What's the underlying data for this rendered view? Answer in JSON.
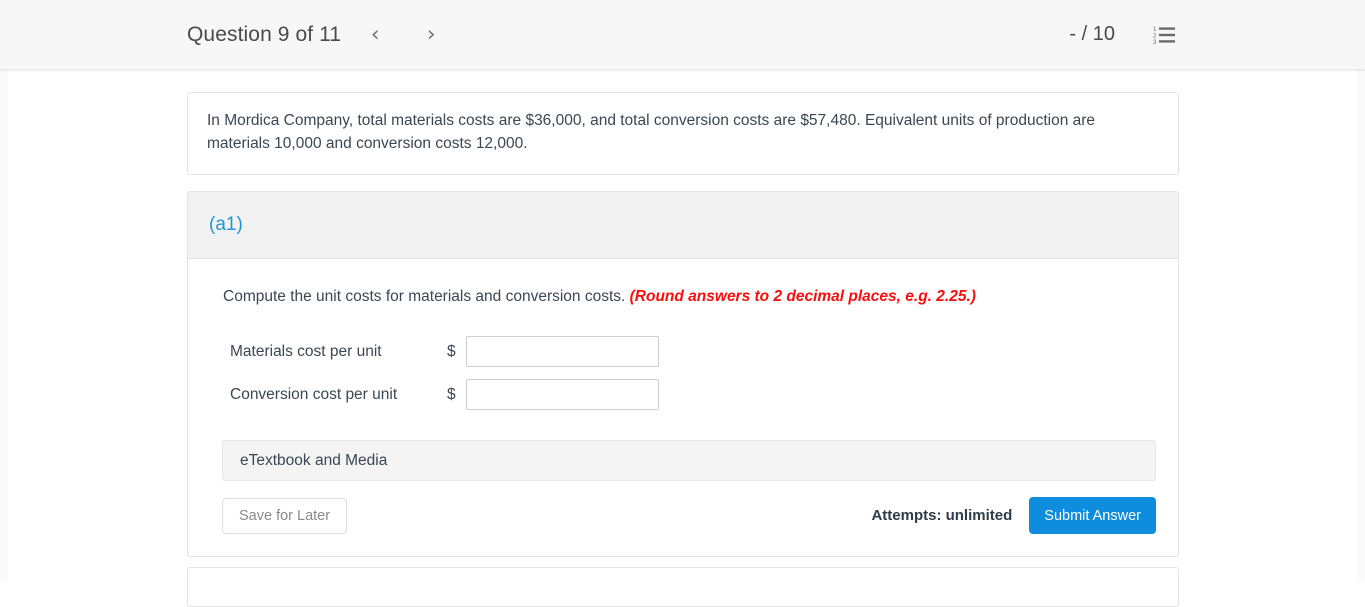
{
  "header": {
    "question_title": "Question 9 of 11",
    "prev_icon": "chevron-left-icon",
    "next_icon": "chevron-right-icon",
    "prev_glyph": "‹",
    "next_glyph": "›",
    "score": "- / 10",
    "list_icon": "numbered-list-icon"
  },
  "statement": {
    "text": "In Mordica Company, total materials costs are $36,000, and total conversion costs are $57,480. Equivalent units of production are materials 10,000 and conversion costs 12,000."
  },
  "part": {
    "label": "(a1)",
    "prompt": "Compute the unit costs for materials and conversion costs.",
    "prompt_note": "(Round answers to 2 decimal places, e.g. 2.25.)",
    "rows": [
      {
        "label": "Materials cost per unit",
        "currency": "$",
        "value": "",
        "placeholder": ""
      },
      {
        "label": "Conversion cost per unit",
        "currency": "$",
        "value": "",
        "placeholder": ""
      }
    ],
    "etextbook_label": "eTextbook and Media",
    "save_label": "Save for Later",
    "attempts_label": "Attempts: unlimited",
    "submit_label": "Submit Answer"
  },
  "colors": {
    "accent_blue": "#1e96dd",
    "submit_blue": "#0e8cdd",
    "alert_red": "#fc0d0d",
    "text": "#3a4754",
    "header_bg": "#f7f7f8",
    "panel_head_bg": "#f2f2f2"
  }
}
